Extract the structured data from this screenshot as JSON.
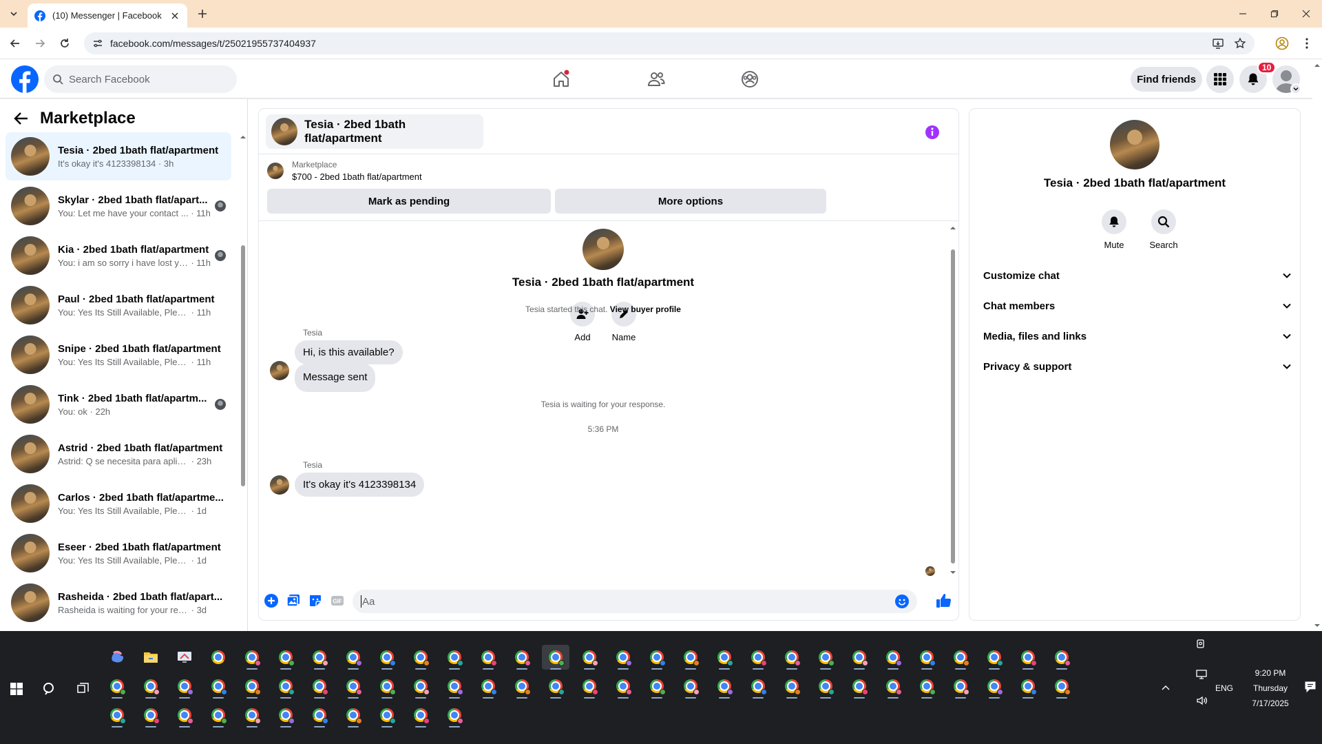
{
  "browser": {
    "tab_title": "(10) Messenger | Facebook",
    "url": "facebook.com/messages/t/25021955737404937"
  },
  "fb": {
    "search_placeholder": "Search Facebook",
    "find_friends": "Find friends",
    "notif_count": "10",
    "brand_color": "#0866ff"
  },
  "sidebar": {
    "title": "Marketplace",
    "conversations": [
      {
        "name": "Tesia · 2bed 1bath flat/apartment",
        "preview": "It's okay it's 4123398134",
        "time": "3h",
        "active": true,
        "seen": false
      },
      {
        "name": "Skylar · 2bed 1bath flat/apart...",
        "preview": "You: Let me have your contact ...",
        "time": "11h",
        "active": false,
        "seen": true
      },
      {
        "name": "Kia · 2bed 1bath flat/apartment",
        "preview": "You: i am so sorry i have lost yo...",
        "time": "11h",
        "active": false,
        "seen": true
      },
      {
        "name": "Paul · 2bed 1bath flat/apartment",
        "preview": "You: Yes Its Still Available, Please S...",
        "time": "11h",
        "active": false,
        "seen": false
      },
      {
        "name": "Snipe · 2bed 1bath flat/apartment",
        "preview": "You: Yes Its Still Available, Please S...",
        "time": "11h",
        "active": false,
        "seen": false
      },
      {
        "name": "Tink · 2bed 1bath flat/apartm...",
        "preview": "You: ok",
        "time": "22h",
        "active": false,
        "seen": true
      },
      {
        "name": "Astrid · 2bed 1bath flat/apartment",
        "preview": "Astrid: Q se necesita para aplicar",
        "time": "23h",
        "active": false,
        "seen": false
      },
      {
        "name": "Carlos · 2bed 1bath flat/apartme...",
        "preview": "You: Yes Its Still Available, Please Se...",
        "time": "1d",
        "active": false,
        "seen": false
      },
      {
        "name": "Eseer · 2bed 1bath flat/apartment",
        "preview": "You: Yes Its Still Available, Please Se...",
        "time": "1d",
        "active": false,
        "seen": false
      },
      {
        "name": "Rasheida · 2bed 1bath flat/apart...",
        "preview": "Rasheida is waiting for your respon...",
        "time": "3d",
        "active": false,
        "seen": false
      }
    ]
  },
  "chat": {
    "title": "Tesia · 2bed 1bath flat/apartment",
    "marketplace_label": "Marketplace",
    "listing": "$700 - 2bed 1bath flat/apartment",
    "mark_pending": "Mark as pending",
    "more_options": "More options",
    "profile_name": "Tesia · 2bed 1bath flat/apartment",
    "add_label": "Add",
    "name_label": "Name",
    "started_text": "Tesia started this chat.",
    "view_buyer": "View buyer profile",
    "sender_name": "Tesia",
    "messages": [
      "Hi, is this available?",
      "Message sent",
      "It's okay it's 4123398134"
    ],
    "waiting_text": "Tesia is waiting for your response.",
    "timestamp": "5:36 PM",
    "composer_placeholder": "Aa"
  },
  "info": {
    "name": "Tesia · 2bed 1bath flat/apartment",
    "mute": "Mute",
    "search": "Search",
    "sections": [
      "Customize chat",
      "Chat members",
      "Media, files and links",
      "Privacy & support"
    ]
  },
  "taskbar": {
    "time": "9:20 PM",
    "day": "Thursday",
    "date": "7/17/2025",
    "lang": "ENG"
  }
}
